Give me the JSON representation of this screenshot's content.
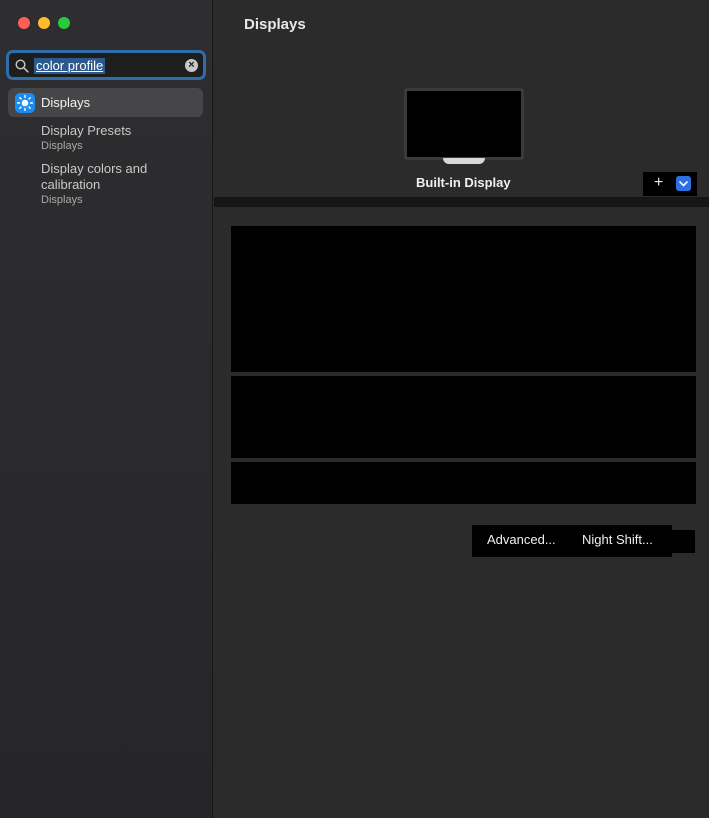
{
  "window": {
    "traffic_lights": [
      "close",
      "minimize",
      "maximize"
    ]
  },
  "sidebar": {
    "search": {
      "value": "color profile",
      "icon": "search-icon",
      "clear_icon": "clear-icon"
    },
    "results": [
      {
        "label": "Displays",
        "icon": "displays-icon",
        "selected": true
      }
    ],
    "sub_results": [
      {
        "title": "Display Presets",
        "category": "Displays"
      },
      {
        "title_line1": "Display colors and",
        "title_line2": "calibration",
        "category": "Displays"
      }
    ]
  },
  "main": {
    "title": "Displays",
    "display_name": "Built-in Display",
    "add_symbol": "+",
    "buttons": {
      "advanced": "Advanced...",
      "night_shift": "Night Shift..."
    }
  },
  "colors": {
    "accent": "#2f6fe0",
    "selection": "#464648",
    "search_focus": "#2f6ea8"
  }
}
